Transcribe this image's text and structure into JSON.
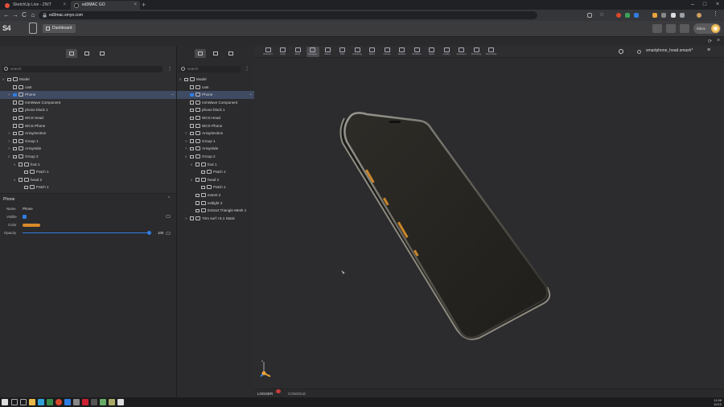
{
  "browser": {
    "tabs": [
      {
        "label": "SketchUp Live - ZNIT",
        "active": false,
        "color": "#e0523a"
      },
      {
        "label": "ed3MAC GO",
        "active": true,
        "color": "#333"
      }
    ],
    "new_tab": "+",
    "url": "ed3mac.smyo.com",
    "nav": {
      "back": "←",
      "forward": "→",
      "reload": "C",
      "home": "⌂"
    }
  },
  "app": {
    "logo_text": "S4",
    "logo_accent": "",
    "dashboard_label": "Dashboard",
    "user_label": "inbox",
    "filename": "smartphone_head.smash*",
    "accent": "#3f4a63"
  },
  "left_panel": {
    "search_placeholder": "search",
    "tree": [
      {
        "label": "Model",
        "level": 0,
        "arrow": "v",
        "selected": false
      },
      {
        "label": "cast",
        "level": 1,
        "arrow": "",
        "selected": false
      },
      {
        "label": "Phone",
        "level": 1,
        "arrow": ">",
        "selected": true
      },
      {
        "label": "mmWave Component",
        "level": 1,
        "arrow": "",
        "selected": false
      },
      {
        "label": "phone block 1",
        "level": 1,
        "arrow": "",
        "selected": false
      },
      {
        "label": "WCS Head",
        "level": 1,
        "arrow": "",
        "selected": false
      },
      {
        "label": "WCS Phone",
        "level": 1,
        "arrow": "",
        "selected": false
      },
      {
        "label": "ArraySection",
        "level": 1,
        "arrow": ">",
        "selected": false
      },
      {
        "label": "Group 1",
        "level": 1,
        "arrow": ">",
        "selected": false
      },
      {
        "label": "ArraySide",
        "level": 1,
        "arrow": ">",
        "selected": false
      },
      {
        "label": "Group 2",
        "level": 1,
        "arrow": "v",
        "selected": false
      },
      {
        "label": "foot 1",
        "level": 2,
        "arrow": "v",
        "selected": false
      },
      {
        "label": "Patch 1",
        "level": 3,
        "arrow": "",
        "selected": false
      },
      {
        "label": "head 2",
        "level": 2,
        "arrow": "v",
        "selected": false
      },
      {
        "label": "Patch 1",
        "level": 3,
        "arrow": "",
        "selected": false
      }
    ]
  },
  "properties": {
    "title": "Phone",
    "name_label": "Name",
    "name_value": "Phone",
    "visible_label": "Visible",
    "color_label": "Color",
    "color_value": "#d88a2a",
    "opacity_label": "Opacity",
    "opacity_value": "100",
    "opacity_fraction": 1.0
  },
  "mid_panel": {
    "search_placeholder": "search",
    "tree": [
      {
        "label": "Model",
        "level": 0,
        "arrow": "v",
        "selected": false
      },
      {
        "label": "cast",
        "level": 1,
        "arrow": "",
        "selected": false
      },
      {
        "label": "Phone",
        "level": 1,
        "arrow": "",
        "selected": true
      },
      {
        "label": "mmWave Component",
        "level": 1,
        "arrow": "",
        "selected": false
      },
      {
        "label": "phone block 1",
        "level": 1,
        "arrow": "",
        "selected": false
      },
      {
        "label": "WCS Head",
        "level": 1,
        "arrow": "",
        "selected": false
      },
      {
        "label": "WCS Phone",
        "level": 1,
        "arrow": "",
        "selected": false
      },
      {
        "label": "ArraySection",
        "level": 1,
        "arrow": ">",
        "selected": false
      },
      {
        "label": "Group 1",
        "level": 1,
        "arrow": ">",
        "selected": false
      },
      {
        "label": "ArraySide",
        "level": 1,
        "arrow": ">",
        "selected": false
      },
      {
        "label": "Group 2",
        "level": 1,
        "arrow": "v",
        "selected": false
      },
      {
        "label": "foot 1",
        "level": 2,
        "arrow": "v",
        "selected": false
      },
      {
        "label": "Patch 1",
        "level": 3,
        "arrow": "",
        "selected": false
      },
      {
        "label": "head 2",
        "level": 2,
        "arrow": "v",
        "selected": false
      },
      {
        "label": "Patch 1",
        "level": 3,
        "arrow": "",
        "selected": false
      },
      {
        "label": "extent 2",
        "level": 2,
        "arrow": "",
        "selected": false
      },
      {
        "label": "extlight 2",
        "level": 2,
        "arrow": "",
        "selected": false
      },
      {
        "label": "Extract Triangle Mesh 1",
        "level": 2,
        "arrow": "",
        "selected": false
      },
      {
        "label": "Trim surf ×3.1 Static",
        "level": 1,
        "arrow": ">",
        "selected": false
      }
    ]
  },
  "toolbar": [
    {
      "label": "Reimport",
      "icon": "import-icon"
    },
    {
      "label": "Undo",
      "icon": "undo-icon"
    },
    {
      "label": "Redo",
      "icon": "redo-icon"
    },
    {
      "label": "Navigate",
      "icon": "navigate-icon",
      "active": true
    },
    {
      "label": "Select",
      "icon": "select-icon"
    },
    {
      "label": "Pick",
      "icon": "pick-icon"
    },
    {
      "label": "Clamping",
      "icon": "clamp-icon"
    },
    {
      "label": "Bend",
      "icon": "bend-icon"
    },
    {
      "label": "Curves",
      "icon": "curves-icon"
    },
    {
      "label": "Surface",
      "icon": "surface-icon"
    },
    {
      "label": "Modifiers",
      "icon": "modifiers-icon"
    },
    {
      "label": "Mesh",
      "icon": "mesh-icon"
    },
    {
      "label": "Quality",
      "icon": "quality-icon"
    },
    {
      "label": "Comment",
      "icon": "comment-icon"
    },
    {
      "label": "Bounding",
      "icon": "bounding-icon"
    },
    {
      "label": "View Mode",
      "icon": "viewmode-icon"
    }
  ],
  "logger": {
    "logger_label": "LOGGER",
    "log_count": "1",
    "console_label": "CONSOLE"
  },
  "taskbar": {
    "time": "11:58",
    "date": "10/10"
  }
}
